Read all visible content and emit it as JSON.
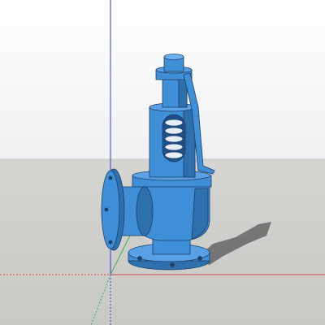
{
  "viewport": {
    "model": "safety-relief-valve",
    "view": "3d-perspective",
    "colors": {
      "sky": "#f4f5f6",
      "ground": "#cbcbc7",
      "model": "#3f8ed8",
      "model_dark": "#2e6fae",
      "model_light": "#6eb0ee",
      "shadow": "#6b6b6b",
      "axis_red": "#d64545",
      "axis_green": "#3fae52",
      "axis_blue": "#3a3ad8"
    }
  }
}
